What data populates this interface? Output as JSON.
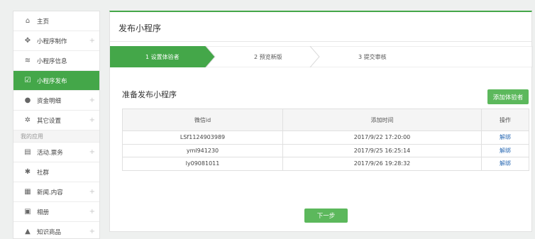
{
  "sidebar": {
    "items": [
      {
        "label": "主页",
        "icon": "home-icon",
        "glyph": "⌂",
        "plus": ""
      },
      {
        "label": "小程序制作",
        "icon": "move-icon",
        "glyph": "✥",
        "plus": "+"
      },
      {
        "label": "小程序信息",
        "icon": "layers-icon",
        "glyph": "≋",
        "plus": ""
      },
      {
        "label": "小程序发布",
        "icon": "checkbox-icon",
        "glyph": "☑",
        "plus": ""
      },
      {
        "label": "资金明细",
        "icon": "money-bag-icon",
        "glyph": "●",
        "plus": "+"
      },
      {
        "label": "其它设置",
        "icon": "gear-icon",
        "glyph": "✲",
        "plus": "+"
      }
    ],
    "section_label": "我的应用",
    "apps": [
      {
        "label": "活动.票务",
        "icon": "ticket-icon",
        "glyph": "▤",
        "plus": "+"
      },
      {
        "label": "社群",
        "icon": "community-icon",
        "glyph": "✱",
        "plus": ""
      },
      {
        "label": "新闻.内容",
        "icon": "news-icon",
        "glyph": "▦",
        "plus": "+"
      },
      {
        "label": "相册",
        "icon": "photo-icon",
        "glyph": "▣",
        "plus": "+"
      },
      {
        "label": "知识商品",
        "icon": "graduation-cap-icon",
        "glyph": "▲",
        "plus": "+"
      }
    ],
    "active_color": "#44a749"
  },
  "main": {
    "title": "发布小程序",
    "steps": [
      "1 设置体验者",
      "2 预览新版",
      "3 提交审核"
    ],
    "section_title": "准备发布小程序",
    "add_button": "添加体验者",
    "table": {
      "headers": [
        "微信id",
        "添加时间",
        "操作"
      ],
      "rows": [
        {
          "id": "LSf1124903989",
          "time": "2017/9/22 17:20:00",
          "action": "解绑"
        },
        {
          "id": "yml941230",
          "time": "2017/9/25 16:25:14",
          "action": "解绑"
        },
        {
          "id": "ly09081011",
          "time": "2017/9/26 19:28:32",
          "action": "解绑"
        }
      ]
    },
    "next_button": "下一步"
  }
}
